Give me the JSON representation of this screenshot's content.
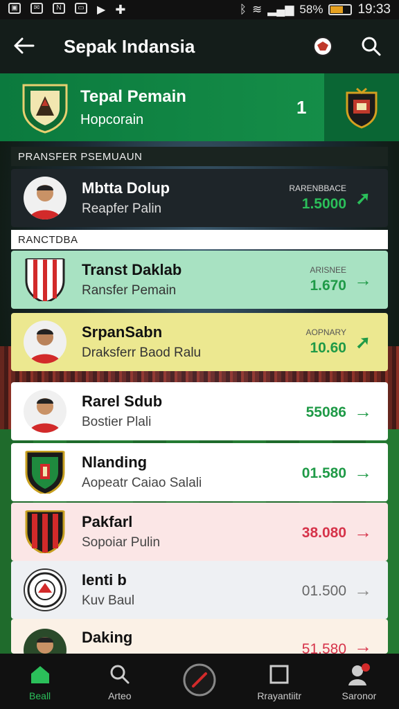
{
  "status_bar": {
    "battery": "58%",
    "time": "19:33",
    "icons": [
      "gallery-icon",
      "mail-icon",
      "n-icon",
      "message-icon",
      "play-icon",
      "plus-icon"
    ]
  },
  "app_bar": {
    "title": "Sepak Indansia",
    "back_icon": "back-arrow-icon",
    "actions": [
      "ball-icon",
      "search-icon"
    ]
  },
  "hero": {
    "title": "Tepal Pemain",
    "subtitle": "Hopcorain",
    "count": "1"
  },
  "sections": {
    "first": "PRANSFER PSEMUAUN",
    "second": "RANCTDBA"
  },
  "rows": [
    {
      "name": "Mbtta Dolup",
      "sub": "Reapfer Palin",
      "tag": "RARENBBACE",
      "value": "1.5000",
      "avatar": "player-avatar",
      "arrow": "up-right-arrow-icon"
    },
    {
      "name": "Transt Daklab",
      "sub": "Ransfer Pemain",
      "tag": "ARISNEE",
      "value": "1.670",
      "avatar": "club-crest-striped",
      "arrow": "right-arrow-icon"
    },
    {
      "name": "SrpanSabn",
      "sub": "Draksferr Baod Ralu",
      "tag": "AOPNARY",
      "value": "10.60",
      "avatar": "player-avatar",
      "arrow": "up-right-arrow-icon"
    },
    {
      "name": "Rarel Sdub",
      "sub": "Bostier Plali",
      "tag": "",
      "value": "55086",
      "avatar": "player-avatar",
      "arrow": "right-arrow-icon"
    },
    {
      "name": "Nlanding",
      "sub": "Aopeatr Caiao Salali",
      "tag": "",
      "value": "01.580",
      "avatar": "club-crest-green",
      "arrow": "right-arrow-icon"
    },
    {
      "name": "Pakfarl",
      "sub": "Sopoiar Pulin",
      "tag": "",
      "value": "38.080",
      "avatar": "club-crest-red",
      "arrow": "right-arrow-icon"
    },
    {
      "name": "Ienti b",
      "sub": "Kuv Baul",
      "tag": "",
      "value": "01.500",
      "avatar": "club-crest-round",
      "arrow": "right-arrow-icon"
    },
    {
      "name": "Daking",
      "sub": "",
      "tag": "",
      "value": "51.580",
      "avatar": "player-avatar",
      "arrow": "right-arrow-icon"
    }
  ],
  "tabs": [
    {
      "label": "Beall",
      "icon": "home-icon",
      "active": true
    },
    {
      "label": "Arteo",
      "icon": "search-icon",
      "active": false
    },
    {
      "label": "",
      "icon": "ball-icon",
      "active": false
    },
    {
      "label": "Rrayantiitr",
      "icon": "square-icon",
      "active": false
    },
    {
      "label": "Saronor",
      "icon": "profile-icon",
      "active": false
    }
  ],
  "colors": {
    "accent_green": "#0b7a3e",
    "value_green": "#1f9a47",
    "value_red": "#d6334a",
    "value_gray": "#666666"
  }
}
